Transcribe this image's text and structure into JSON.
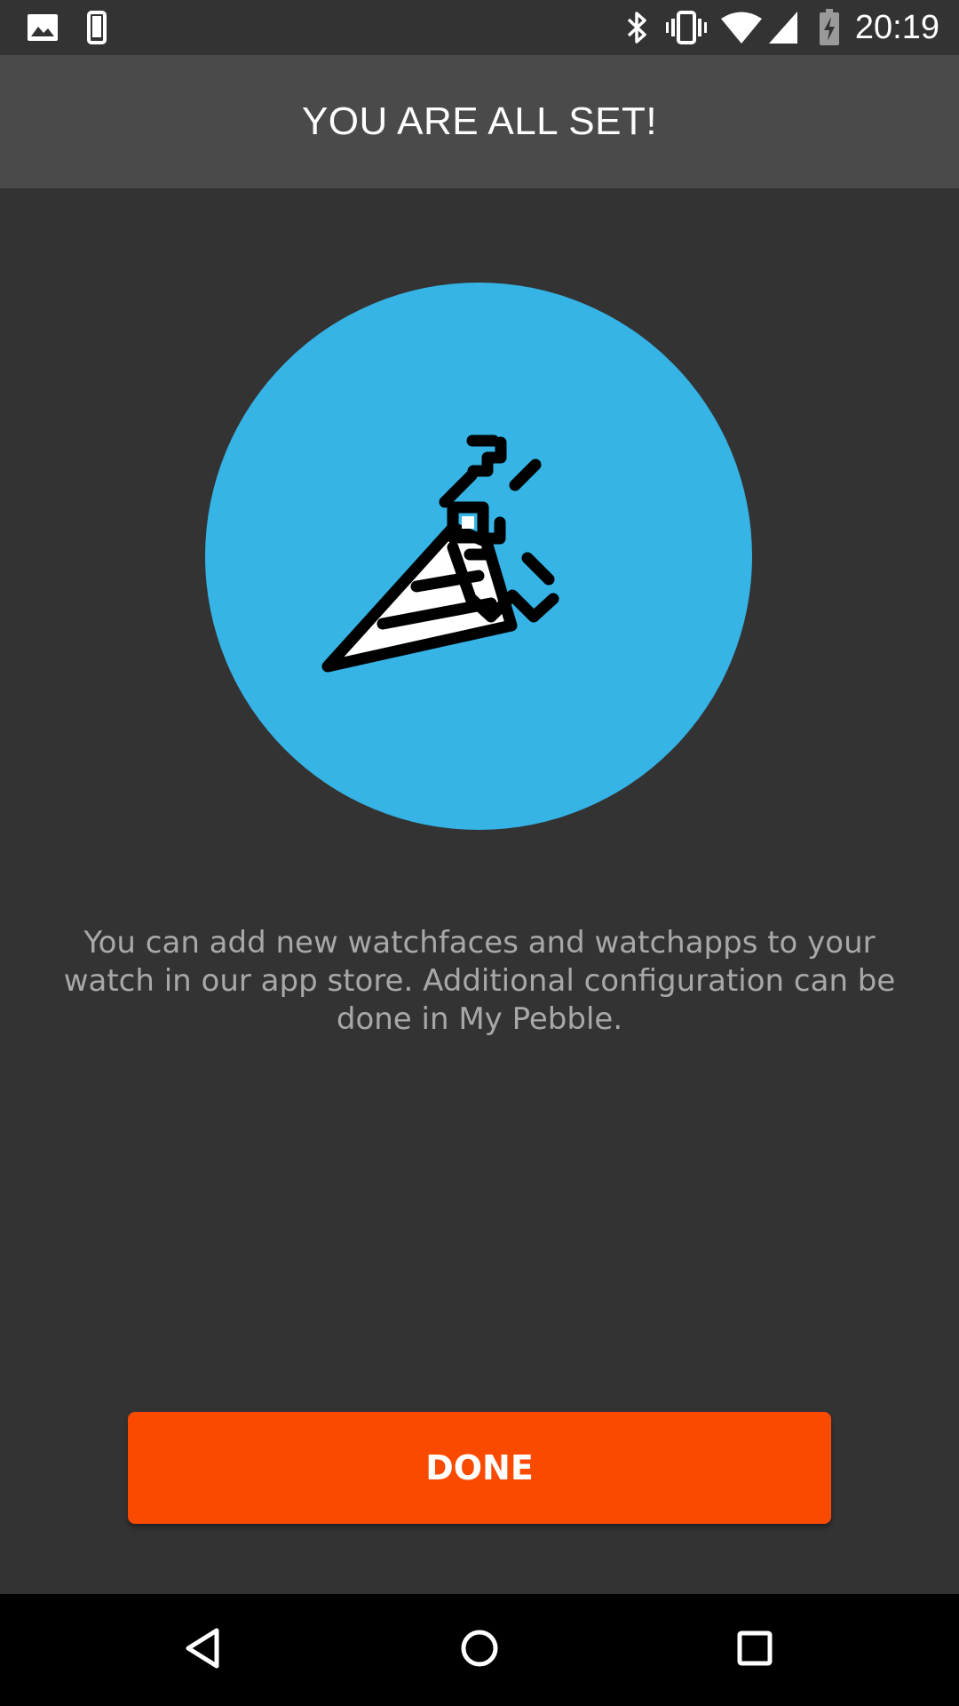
{
  "status_bar": {
    "time": "20:19",
    "left_icons": [
      "image-icon",
      "phone-icon"
    ],
    "right_icons": [
      "bluetooth-icon",
      "vibrate-icon",
      "wifi-icon",
      "signal-icon",
      "battery-charging-icon"
    ]
  },
  "app_bar": {
    "title": "YOU ARE ALL SET!"
  },
  "hero": {
    "icon": "party-popper-icon",
    "circle_color": "#35b4e5"
  },
  "main": {
    "description": "You can add new watchfaces and watchapps to your watch in our app store. Additional configuration can be done in My Pebble."
  },
  "actions": {
    "done_label": "DONE",
    "done_color": "#fa4a00"
  },
  "nav_bar": {
    "buttons": [
      "back-icon",
      "home-icon",
      "recents-icon"
    ]
  }
}
